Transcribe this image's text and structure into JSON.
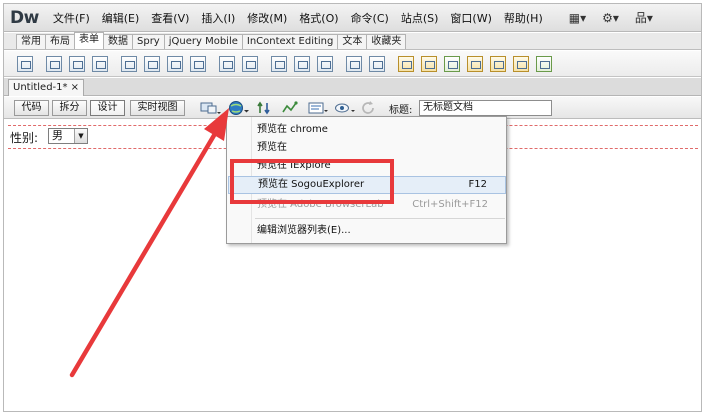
{
  "app": {
    "logo": "Dw",
    "menu": [
      "文件(F)",
      "编辑(E)",
      "查看(V)",
      "插入(I)",
      "修改(M)",
      "格式(O)",
      "命令(C)",
      "站点(S)",
      "窗口(W)",
      "帮助(H)"
    ],
    "menu_icons": [
      "layout-icon",
      "gear-icon",
      "sitemap-icon"
    ]
  },
  "insert_tabs": {
    "items": [
      "常用",
      "布局",
      "表单",
      "数据",
      "Spry",
      "jQuery Mobile",
      "InContext Editing",
      "文本",
      "收藏夹"
    ],
    "active": "表单"
  },
  "document": {
    "tab_label": "Untitled-1*",
    "close_label": "×"
  },
  "view_toolbar": {
    "code": "代码",
    "split": "拆分",
    "design": "设计",
    "live": "实时视图",
    "title_label": "标题:",
    "title_value": "无标题文档"
  },
  "canvas": {
    "gender_label": "性别:",
    "gender_value": "男",
    "select_arrow": "▼"
  },
  "preview_menu": {
    "items": [
      {
        "label": "预览在 chrome",
        "shortcut": ""
      },
      {
        "label": "预览在",
        "shortcut": ""
      },
      {
        "label": "预览在 IExplore",
        "shortcut": ""
      },
      {
        "label": "预览在 SogouExplorer",
        "shortcut": "F12"
      },
      {
        "label": "预览在 Adobe BrowserLab",
        "shortcut": "Ctrl+Shift+F12"
      },
      {
        "label": "编辑浏览器列表(E)...",
        "shortcut": ""
      }
    ]
  },
  "colors": {
    "annotation_red": "#e8393b",
    "highlight_blue": "#e5eef8"
  }
}
